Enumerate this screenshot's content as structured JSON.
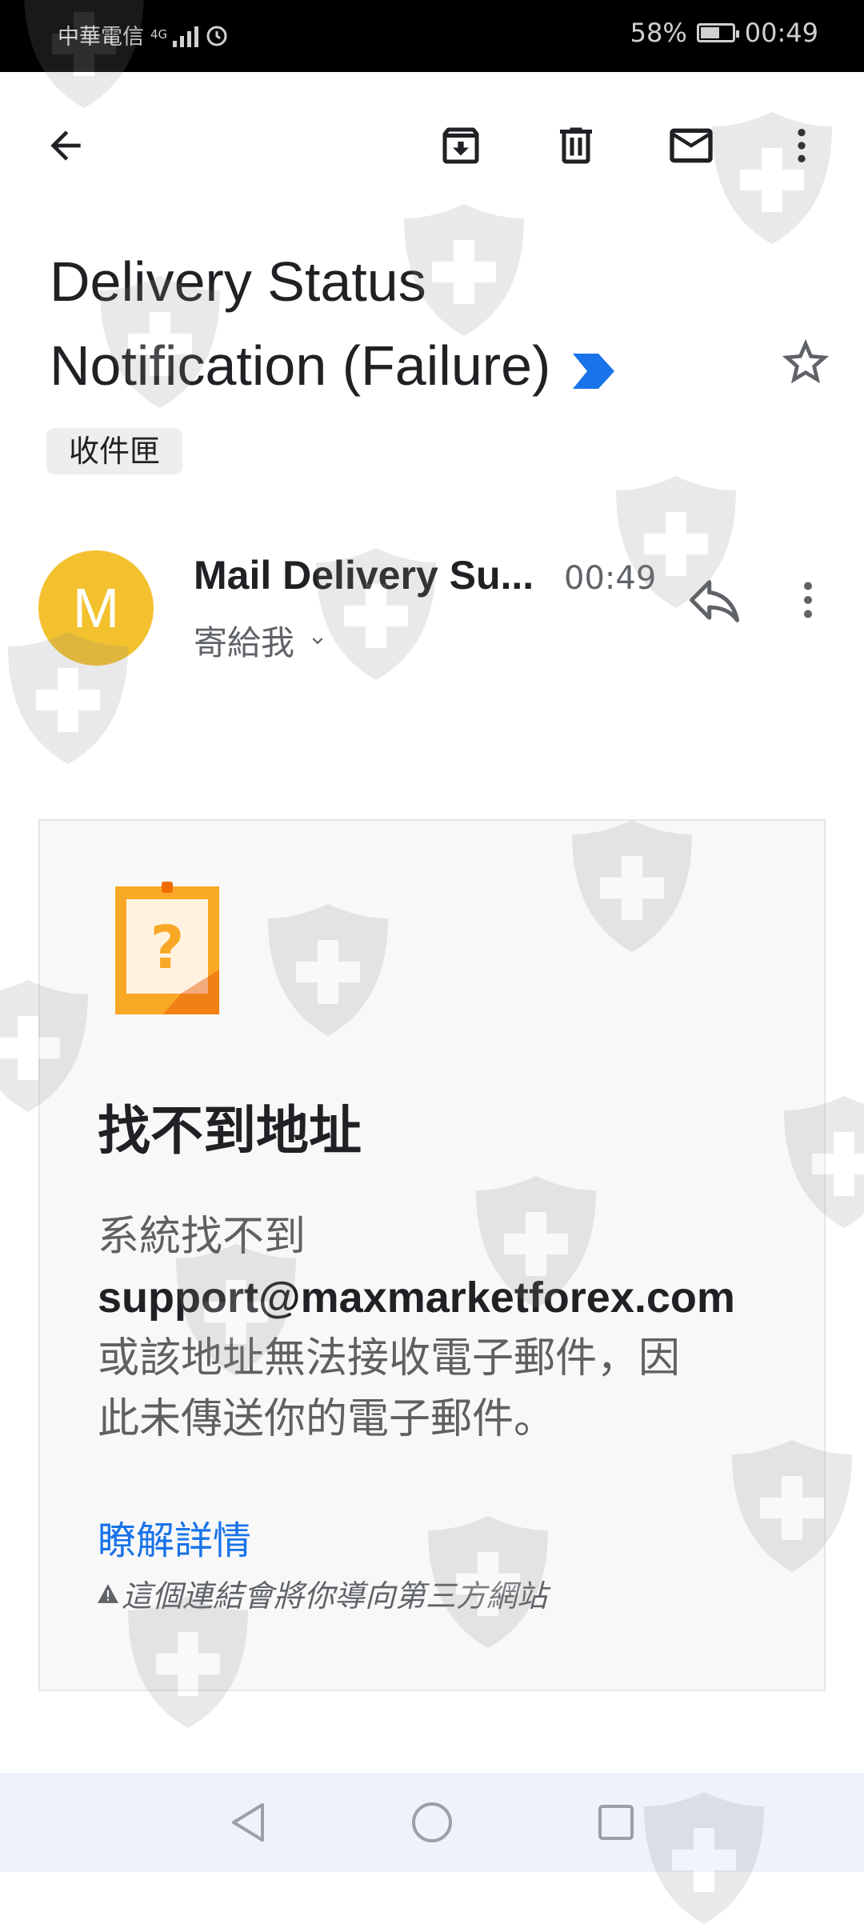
{
  "status_bar": {
    "carrier": "中華電信",
    "network": "4G",
    "battery": "58%",
    "time": "00:49"
  },
  "toolbar": {
    "back_icon": "arrow-left-icon",
    "archive_icon": "archive-icon",
    "delete_icon": "trash-icon",
    "mark_unread_icon": "mail-icon",
    "more_icon": "more-vert-icon"
  },
  "email": {
    "subject_line1": "Delivery Status",
    "subject_line2": "Notification (Failure)",
    "label_chip": "收件匣",
    "sender_initial": "M",
    "sender_name": "Mail Delivery Su...",
    "time": "00:49",
    "to_line": "寄給我",
    "avatar_color": "#f2c12d"
  },
  "card": {
    "title": "找不到地址",
    "body_line1": "系統找不到",
    "email_address": "support@maxmarketforex.com",
    "body_line2": "或該地址無法接收電子郵件，因",
    "body_line3": "此未傳送你的電子郵件。",
    "learn_more": "瞭解詳情",
    "warning_text": "這個連結會將你導向第三方網站"
  },
  "nav": {
    "back_icon": "triangle-back-icon",
    "home_icon": "circle-home-icon",
    "recents_icon": "square-recents-icon"
  },
  "colors": {
    "accent": "#1a73e8",
    "important_marker": "#1a73e8"
  }
}
